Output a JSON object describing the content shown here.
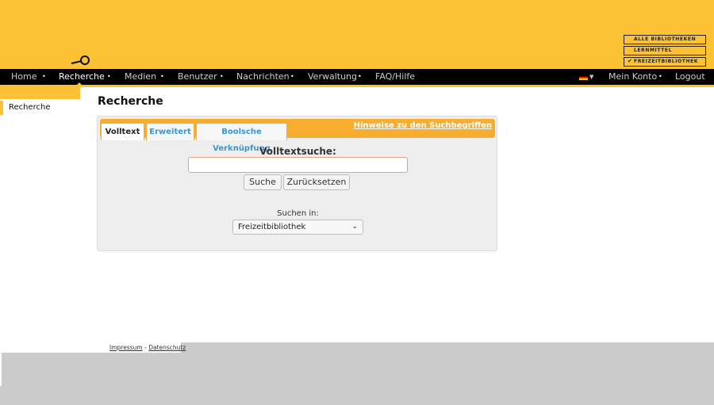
{
  "header": {
    "libraries": [
      {
        "label": "ALLE BIBLIOTHEKEN",
        "checked": false
      },
      {
        "label": "LERNMITTEL",
        "checked": false
      },
      {
        "label": "FREIZEITBIBLIOTHEK",
        "checked": true
      }
    ],
    "check": "✔"
  },
  "nav": {
    "items": [
      "Home",
      "Recherche",
      "Medien",
      "Benutzer",
      "Nachrichten",
      "Verwaltung",
      "FAQ/Hilfe"
    ],
    "active": "Recherche",
    "account": "Mein Konto",
    "logout": "Logout",
    "separator": "•"
  },
  "sidebar": {
    "items": [
      "Recherche"
    ]
  },
  "page": {
    "title": "Recherche"
  },
  "search": {
    "tabs": [
      "Volltext",
      "Erweitert",
      "Boolsche Verknüpfung"
    ],
    "active_tab": "Volltext",
    "hint_link": "Hinweise zu den Suchbegriffen",
    "label": "Volltextsuche:",
    "query": "",
    "search_button": "Suche",
    "reset_button": "Zurücksetzen",
    "scope_label": "Suchen in:",
    "scope_value": "Freizeitbibliothek"
  },
  "footer": {
    "impressum": "Impressum",
    "sep": "-",
    "datenschutz": "Datenschutz"
  }
}
